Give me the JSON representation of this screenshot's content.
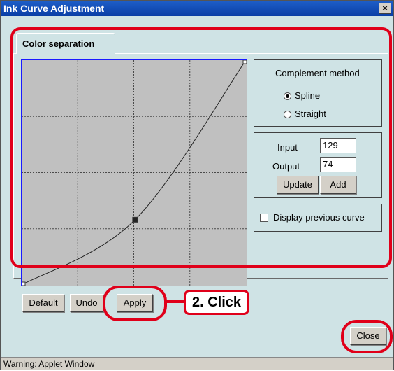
{
  "window": {
    "title": "Ink Curve Adjustment",
    "close_glyph": "×"
  },
  "tab": {
    "label": "Color separation"
  },
  "complement": {
    "title": "Complement method",
    "options": [
      {
        "label": "Spline",
        "selected": true
      },
      {
        "label": "Straight",
        "selected": false
      }
    ]
  },
  "point": {
    "input_label": "Input",
    "input_value": "129",
    "output_label": "Output",
    "output_value": "74",
    "update_label": "Update",
    "add_label": "Add"
  },
  "display_previous": {
    "label": "Display previous curve",
    "checked": false
  },
  "buttons": {
    "default_label": "Default",
    "undo_label": "Undo",
    "apply_label": "Apply",
    "close_label": "Close"
  },
  "callout": {
    "text": "2. Click"
  },
  "status": {
    "text": "Warning: Applet Window"
  },
  "curve": {
    "range": [
      0,
      255
    ],
    "grid_divisions": 4,
    "control_points": [
      [
        0,
        0
      ],
      [
        129,
        74
      ],
      [
        255,
        255
      ]
    ]
  },
  "colors": {
    "annotation": "#e0001a",
    "graph_border": "#1a1aff",
    "graph_bg": "#c0c0c0",
    "window_bg": "#cfe3e5",
    "titlebar": "#0a3ea6"
  },
  "icons": {
    "close": "close-icon",
    "radio": "radio-icon",
    "checkbox": "checkbox-icon"
  }
}
